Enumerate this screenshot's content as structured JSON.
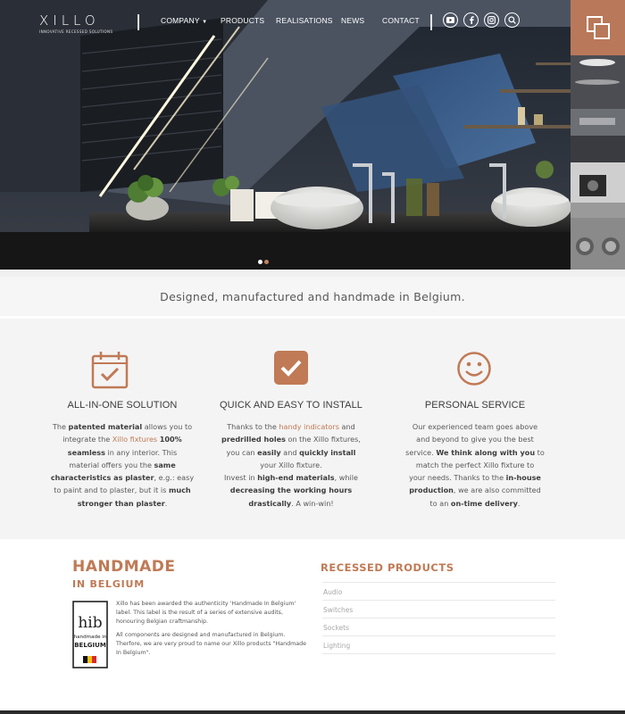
{
  "brand": {
    "logo": "XILLO",
    "tagline": "INNOVATIVE RECESSED SOLUTIONS",
    "accent": "#c07a55",
    "toggle_color": "#b9785a"
  },
  "nav": {
    "items": [
      "COMPANY",
      "PRODUCTS",
      "REALISATIONS",
      "NEWS",
      "CONTACT"
    ],
    "socials": [
      "youtube-icon",
      "facebook-icon",
      "instagram-icon",
      "search-icon"
    ]
  },
  "slider": {
    "slides": 2,
    "active": 2
  },
  "tagline": "Designed, manufactured and handmade in Belgium.",
  "features": [
    {
      "icon": "calendar-check-icon",
      "title": "ALL-IN-ONE SOLUTION",
      "lines": [
        [
          "The ",
          {
            "b": "patented material"
          },
          " allows you to"
        ],
        [
          "integrate the ",
          {
            "a": "Xillo fixtures"
          },
          " ",
          {
            "b": "100%"
          }
        ],
        [
          {
            "b": "seamless"
          },
          " in any interior. This"
        ],
        [
          "material offers you the ",
          {
            "b": "same"
          }
        ],
        [
          {
            "b": "characteristics as plaster"
          },
          ", e.g.: easy"
        ],
        [
          "to paint and to plaster, but it is ",
          {
            "b": "much"
          }
        ],
        [
          {
            "b": "stronger than plaster"
          },
          "."
        ]
      ]
    },
    {
      "icon": "checkbox-icon",
      "title": "QUICK AND EASY TO INSTALL",
      "lines": [
        [
          "Thanks to the ",
          {
            "a": "handy indicators"
          },
          " and"
        ],
        [
          {
            "b": "predrilled holes"
          },
          " on the Xillo fixtures,"
        ],
        [
          "you can ",
          {
            "b": "easily"
          },
          " and ",
          {
            "b": "quickly"
          },
          "  ",
          {
            "b": "install"
          }
        ],
        [
          "your Xillo fixture."
        ],
        [
          "Invest in ",
          {
            "b": "high-end materials"
          },
          ", while"
        ],
        [
          {
            "b": "decreasing the working hours"
          }
        ],
        [
          {
            "b": "drastically"
          },
          ". A win-win!"
        ]
      ]
    },
    {
      "icon": "smiley-icon",
      "title": "PERSONAL SERVICE",
      "lines": [
        [
          "Our experienced team goes above"
        ],
        [
          "and beyond to give you the best"
        ],
        [
          "service. ",
          {
            "b": "We think along with you"
          },
          " to"
        ],
        [
          "match the perfect Xillo fixture to"
        ],
        [
          "your needs. Thanks to the ",
          {
            "b": "in-house"
          }
        ],
        [
          {
            "b": "production"
          },
          ", we are also committed"
        ],
        [
          "to an ",
          {
            "b": "on-time delivery"
          },
          "."
        ]
      ]
    }
  ],
  "handmade": {
    "title": "HANDMADE",
    "subtitle": "IN BELGIUM",
    "logo_text": "hib handmade in BELGIUM",
    "paragraph_1": "Xillo has been awarded the authenticity 'Handmade In Belgium' label. This label is the result of a series of extensive audits, honouring Belgian craftmanship.",
    "paragraph_2": "All components are designed and manufactured in Belgium. Therfore, we are very proud to name our Xillo products \"Handmade In Belgium\"."
  },
  "recessed": {
    "title": "RECESSED PRODUCTS",
    "items": [
      "Audio",
      "Switches",
      "Sockets",
      "Lighting"
    ]
  }
}
